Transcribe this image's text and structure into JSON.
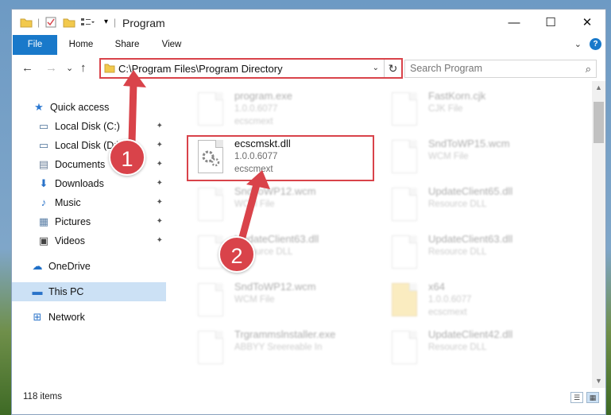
{
  "window": {
    "title": "Program",
    "minimize": "—",
    "maximize": "☐",
    "close": "✕"
  },
  "ribbon": {
    "tabs": [
      "File",
      "Home",
      "Share",
      "View"
    ],
    "collapse": "⌄",
    "help": "?"
  },
  "navigation": {
    "back": "←",
    "forward": "→",
    "recent": "⌄",
    "up": "↑",
    "address": "C:\\Program Files\\Program Directory",
    "address_dropdown": "⌄",
    "refresh": "↻",
    "search_placeholder": "Search Program"
  },
  "sidebar": {
    "items": [
      {
        "label": "Quick access",
        "icon": "star-icon",
        "glyph": "★",
        "color": "#2b78d1",
        "pinned": false
      },
      {
        "label": "Local Disk (C:)",
        "icon": "drive-icon",
        "glyph": "▭",
        "color": "#4a6f97",
        "pinned": true
      },
      {
        "label": "Local Disk (D:)",
        "icon": "drive-icon",
        "glyph": "▭",
        "color": "#4a6f97",
        "pinned": true
      },
      {
        "label": "Documents",
        "icon": "documents-icon",
        "glyph": "▤",
        "color": "#6b7f99",
        "pinned": true
      },
      {
        "label": "Downloads",
        "icon": "download-icon",
        "glyph": "⬇",
        "color": "#2a73c9",
        "pinned": true
      },
      {
        "label": "Music",
        "icon": "music-icon",
        "glyph": "♪",
        "color": "#2a73c9",
        "pinned": true
      },
      {
        "label": "Pictures",
        "icon": "pictures-icon",
        "glyph": "▦",
        "color": "#5b7fa6",
        "pinned": true
      },
      {
        "label": "Videos",
        "icon": "video-icon",
        "glyph": "▣",
        "color": "#444",
        "pinned": true
      },
      {
        "label": "OneDrive",
        "icon": "cloud-icon",
        "glyph": "☁",
        "color": "#1f6fc7",
        "pinned": false
      },
      {
        "label": "This PC",
        "icon": "computer-icon",
        "glyph": "▬",
        "color": "#2a73c9",
        "pinned": false,
        "selected": true
      },
      {
        "label": "Network",
        "icon": "network-icon",
        "glyph": "⊞",
        "color": "#2a73c9",
        "pinned": false
      }
    ],
    "pin_glyph": "📌"
  },
  "files": [
    {
      "name": "program.exe",
      "version": "1.0.0.6077",
      "type": "ecscmext",
      "faded": true
    },
    {
      "name": "FastKorn.cjk",
      "version": "CJK File",
      "type": "",
      "faded": true
    },
    {
      "name": "ecscmskt.dll",
      "version": "1.0.0.6077",
      "type": "ecscmext",
      "faded": false
    },
    {
      "name": "SndToWP15.wcm",
      "version": "WCM File",
      "type": "",
      "faded": true
    },
    {
      "name": "SndToWP12.wcm",
      "version": "WCM File",
      "type": "",
      "faded": true
    },
    {
      "name": "UpdateClient65.dll",
      "version": "Resource DLL",
      "type": "",
      "faded": true
    },
    {
      "name": "UpdateClient63.dll",
      "version": "Resource DLL",
      "type": "",
      "faded": true
    },
    {
      "name": "UpdateClient63.dll",
      "version": "Resource DLL",
      "type": "",
      "faded": true
    },
    {
      "name": "SndToWP12.wcm",
      "version": "WCM File",
      "type": "",
      "faded": true
    },
    {
      "name": "x64",
      "version": "1.0.0.6077",
      "type": "ecscmext",
      "faded": true
    },
    {
      "name": "Trgrammslnstaller.exe",
      "version": "ABBYY Sreereable In",
      "type": "",
      "faded": true
    },
    {
      "name": "UpdateClient42.dll",
      "version": "Resource DLL",
      "type": "",
      "faded": true
    }
  ],
  "status": {
    "item_count": "118 items"
  },
  "annotations": {
    "step1": "1",
    "step2": "2"
  },
  "colors": {
    "accent": "#1979ca",
    "highlight": "#d9434a",
    "selected_bg": "#cce1f5"
  }
}
